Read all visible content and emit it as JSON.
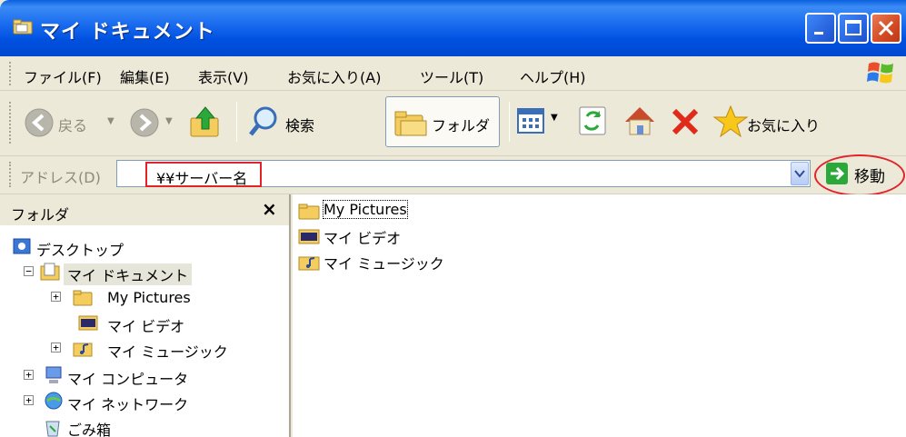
{
  "window": {
    "title": "マイ ドキュメント"
  },
  "menu": {
    "items": [
      "ファイル(F)",
      "編集(E)",
      "表示(V)",
      "お気に入り(A)",
      "ツール(T)",
      "ヘルプ(H)"
    ]
  },
  "toolbar": {
    "back_label": "戻る",
    "search_label": "検索",
    "folders_label": "フォルダ",
    "favorites_label": "お気に入り"
  },
  "address": {
    "label": "アドレス(D)",
    "value": "¥¥サーバー名",
    "go_label": "移動"
  },
  "folder_pane": {
    "title": "フォルダ",
    "close": "×",
    "items": [
      {
        "label": "デスクトップ"
      },
      {
        "label": "マイ ドキュメント"
      },
      {
        "label": "My Pictures"
      },
      {
        "label": "マイ ビデオ"
      },
      {
        "label": "マイ ミュージック"
      },
      {
        "label": "マイ コンピュータ"
      },
      {
        "label": "マイ ネットワーク"
      },
      {
        "label": "ごみ箱"
      }
    ]
  },
  "files": [
    {
      "name": "My Pictures"
    },
    {
      "name": "マイ ビデオ"
    },
    {
      "name": "マイ ミュージック"
    }
  ],
  "colors": {
    "titlebar": "#0a5fde",
    "highlight": "#e0242a",
    "chrome": "#ece9d8"
  }
}
